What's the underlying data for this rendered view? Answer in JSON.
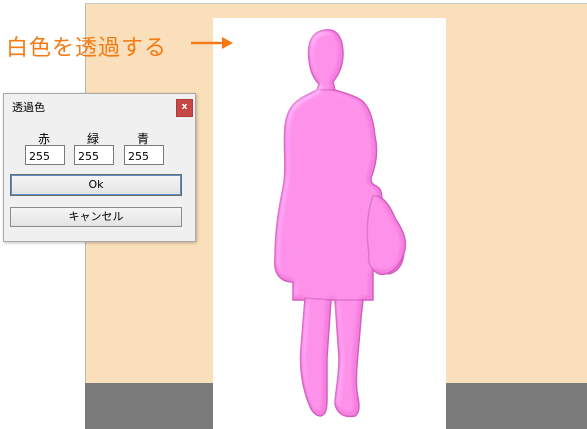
{
  "callout": {
    "text": "白色を透過する"
  },
  "dialog": {
    "title": "透過色",
    "close_label": "x",
    "fields": [
      {
        "label": "赤",
        "value": "255"
      },
      {
        "label": "緑",
        "value": "255"
      },
      {
        "label": "青",
        "value": "255"
      }
    ],
    "ok_label": "Ok",
    "cancel_label": "キャンセル"
  },
  "colors": {
    "background_wall": "#fadfbb",
    "floor": "#7a7a7a",
    "figure_fill": "#f57fe0",
    "callout": "#f47a14",
    "close_button": "#c74747"
  },
  "icons": {
    "arrow": "arrow-right-icon",
    "figure": "person-silhouette"
  }
}
